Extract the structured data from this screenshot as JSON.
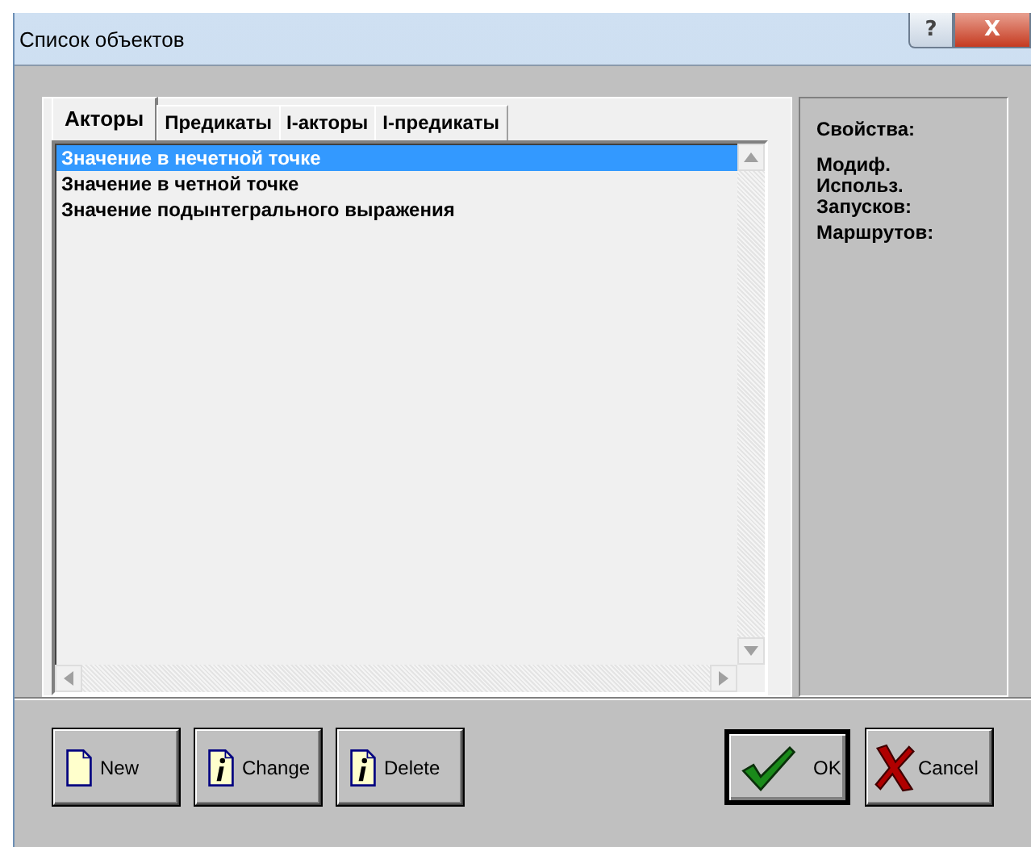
{
  "window": {
    "title": "Список объектов",
    "buttons": [
      "?",
      "X"
    ]
  },
  "tabs": [
    {
      "label": "Акторы",
      "selected": true
    },
    {
      "label": "Предикаты",
      "selected": false
    },
    {
      "label": "I-акторы",
      "selected": false
    },
    {
      "label": "I-предикаты",
      "selected": false
    }
  ],
  "list": {
    "items": [
      {
        "label": "Значение в нечетной точке",
        "selected": true
      },
      {
        "label": "Значение в четной точке",
        "selected": false
      },
      {
        "label": "Значение подынтегрального выражения",
        "selected": false
      }
    ]
  },
  "properties": {
    "title": "Свойства:",
    "fields": [
      "Модиф.",
      "Использ.",
      "Запусков:",
      "Маршрутов:"
    ]
  },
  "buttons": [
    {
      "label": "New",
      "kind": "new",
      "default": false
    },
    {
      "label": "Change",
      "kind": "info",
      "default": false
    },
    {
      "label": "Delete",
      "kind": "info",
      "default": false
    },
    {
      "label": "OK",
      "kind": "ok",
      "default": true
    },
    {
      "label": "Cancel",
      "kind": "cancel",
      "default": false
    }
  ]
}
